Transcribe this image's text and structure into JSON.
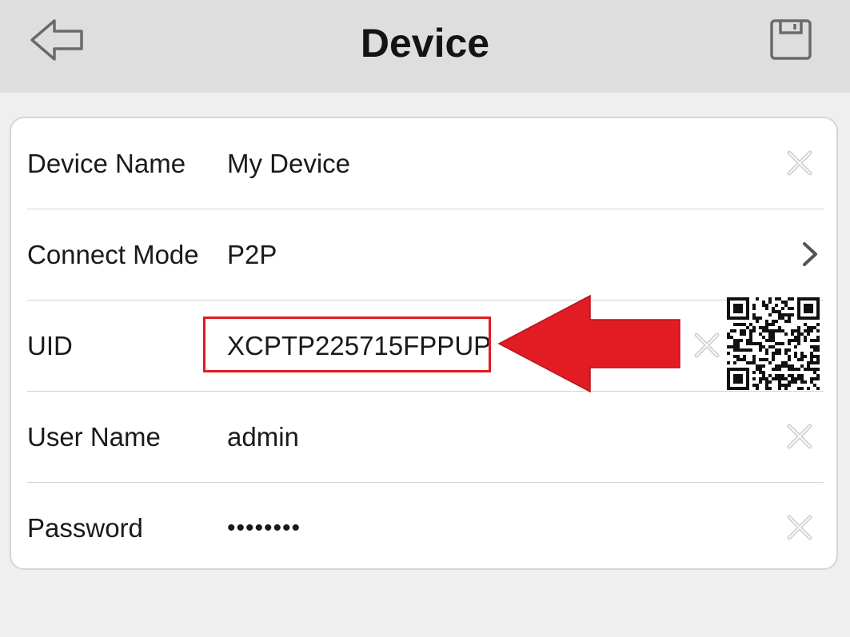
{
  "header": {
    "title": "Device",
    "back_icon": "back-arrow-icon",
    "save_icon": "save-floppy-icon"
  },
  "form": {
    "device_name": {
      "label": "Device Name",
      "value": "My Device",
      "action_icon": "clear-x-icon"
    },
    "connect_mode": {
      "label": "Connect Mode",
      "value": "P2P",
      "action_icon": "chevron-right-icon"
    },
    "uid": {
      "label": "UID",
      "value": "XCPTP225715FPPUP",
      "action_icon": "clear-x-icon",
      "scan_icon": "qr-code-icon"
    },
    "user_name": {
      "label": "User Name",
      "value": "admin",
      "action_icon": "clear-x-icon"
    },
    "password": {
      "label": "Password",
      "value": "••••••••",
      "action_icon": "clear-x-icon"
    }
  },
  "annotation": {
    "highlight_color": "#e31b23"
  },
  "colors": {
    "background": "#efefef",
    "header": "#dedede",
    "card": "#ffffff",
    "text": "#1a1a1a",
    "icon_gray": "#cfcfcf"
  }
}
